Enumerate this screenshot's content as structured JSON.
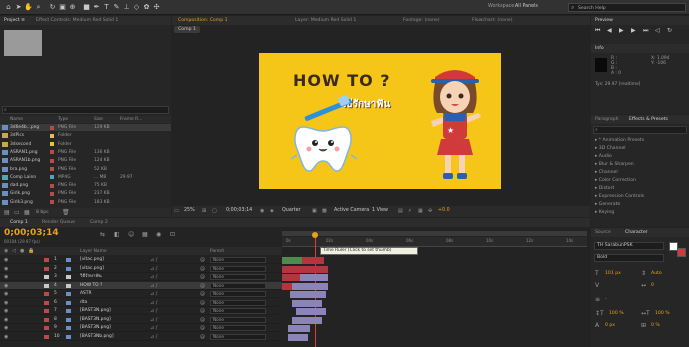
{
  "top_bar": {
    "workspace_label": "Workspace:",
    "workspace_value": "All Panels",
    "search_placeholder": "Search Help"
  },
  "project": {
    "tabs": [
      "Project ≡",
      "Effect Controls: Medium Red Solid 1"
    ],
    "search_value": "",
    "columns": [
      "Name",
      "Type",
      "Size",
      "Frame R..."
    ],
    "items": [
      {
        "name": "3d6e4b...png",
        "type": "PNG File",
        "size": "129 KB",
        "color": "#b94a4a",
        "kind": "file"
      },
      {
        "name": "3dPics",
        "type": "Folder",
        "size": "",
        "color": "#e0c14a",
        "kind": "folder"
      },
      {
        "name": "3dsecond",
        "type": "Folder",
        "size": "",
        "color": "#e0c14a",
        "kind": "folder"
      },
      {
        "name": "ASRAN1.png",
        "type": "PNG File",
        "size": "136 KB",
        "color": "#b94a4a",
        "kind": "file"
      },
      {
        "name": "ASRAN1b.png",
        "type": "PNG File",
        "size": "124 KB",
        "color": "#b94a4a",
        "kind": "file"
      },
      {
        "name": "bra.png",
        "type": "PNG File",
        "size": "52 KB",
        "color": "#b94a4a",
        "kind": "file"
      },
      {
        "name": "Comp Lainn",
        "type": "MP4G",
        "size": "... MB",
        "frame": "29.97",
        "color": "#4fa7b5",
        "kind": "comp"
      },
      {
        "name": "dad.png",
        "type": "PNG File",
        "size": "75 KB",
        "color": "#b94a4a",
        "kind": "file"
      },
      {
        "name": "Girlk.png",
        "type": "PNG File",
        "size": "237 KB",
        "color": "#b94a4a",
        "kind": "file"
      },
      {
        "name": "Girlk3.png",
        "type": "PNG File",
        "size": "183 KB",
        "color": "#b94a4a",
        "kind": "file"
      }
    ],
    "footer_bpc": "8 bpc"
  },
  "composition": {
    "tabs": [
      "Composition: Comp 1",
      "Layer: Medium Red Solid 1",
      "Footage: (none)",
      "Flowchart: (none)"
    ],
    "breadcrumb": "Comp 1",
    "artwork_title": "HOW TO ?",
    "artwork_thai": "วิธีรักษาฟัน",
    "artwork_bg": "#f5c518",
    "zoom": "25%",
    "timecode": "0;00;03;14",
    "resolution": "Quarter",
    "camera": "Active Camera",
    "views": "1 View",
    "offset": "+0.0"
  },
  "info": {
    "tabs": [
      "Preview",
      "Info"
    ],
    "lines": [
      "R :",
      "G :",
      "B :",
      "A : 0"
    ],
    "coords": [
      "X: 1.094",
      "Y: -106"
    ],
    "status": "Tys: 29.97 [realtime]"
  },
  "effects": {
    "tabs": [
      "Paragraph",
      "Effects & Presets"
    ],
    "search_value": "",
    "categories": [
      "* Animation Presets",
      "3D Channel",
      "Audio",
      "Blur & Sharpen",
      "Channel",
      "Color Correction",
      "Distort",
      "Expression Controls",
      "Generate",
      "Keying"
    ]
  },
  "timeline": {
    "tabs": [
      "Comp 1",
      "Render Queue",
      "Comp 2"
    ],
    "timecode": "0;00;03;14",
    "frame_info": "00104 (29.97 fps)",
    "columns": [
      "Layer Name",
      "Parent"
    ],
    "tooltip": "Time Ruler (Click to set thumb)",
    "ruler": [
      "0s",
      "02s",
      "04s",
      "06s",
      "08s",
      "10s",
      "12s",
      "14s"
    ],
    "layers": [
      {
        "num": "1",
        "name": "[vitac.png]",
        "parent": "None",
        "color": "#b94a4a"
      },
      {
        "num": "2",
        "name": "[vitac.png]",
        "parent": "None",
        "color": "#b94a4a"
      },
      {
        "num": "3",
        "name": "วิธีรักษาฟัน",
        "parent": "None",
        "color": "#c8c8c8"
      },
      {
        "num": "4",
        "name": "HOW TO ?",
        "parent": "None",
        "color": "#c8c8c8"
      },
      {
        "num": "5",
        "name": "ASTR",
        "parent": "None",
        "color": "#b94a4a"
      },
      {
        "num": "6",
        "name": "dta",
        "parent": "None",
        "color": "#b94a4a"
      },
      {
        "num": "7",
        "name": "[BAST3N.png]",
        "parent": "None",
        "color": "#b94a4a"
      },
      {
        "num": "8",
        "name": "[BAST3N.png]",
        "parent": "None",
        "color": "#b94a4a"
      },
      {
        "num": "9",
        "name": "[BAST3N.png]",
        "parent": "None",
        "color": "#b94a4a"
      },
      {
        "num": "10",
        "name": "[BAST3Nb.png]",
        "parent": "None",
        "color": "#b94a4a"
      }
    ]
  },
  "character": {
    "tabs": [
      "Source",
      "Character"
    ],
    "font": "TH SarabunPSK",
    "style": "Bold",
    "size_label": "T",
    "size_value": "101 px",
    "leading_value": "Auto",
    "tracking_value": "0",
    "stroke_value": "-",
    "scale_v": "100 %",
    "scale_h": "100 %",
    "baseline": "0 px",
    "tsume": "0 %"
  },
  "colors": {
    "accent": "#e8a11c",
    "playhead": "#e03a3a",
    "bar_red": "#b3353e",
    "bar_purple": "#8a84b8",
    "bar_green": "#4f8a4f"
  }
}
